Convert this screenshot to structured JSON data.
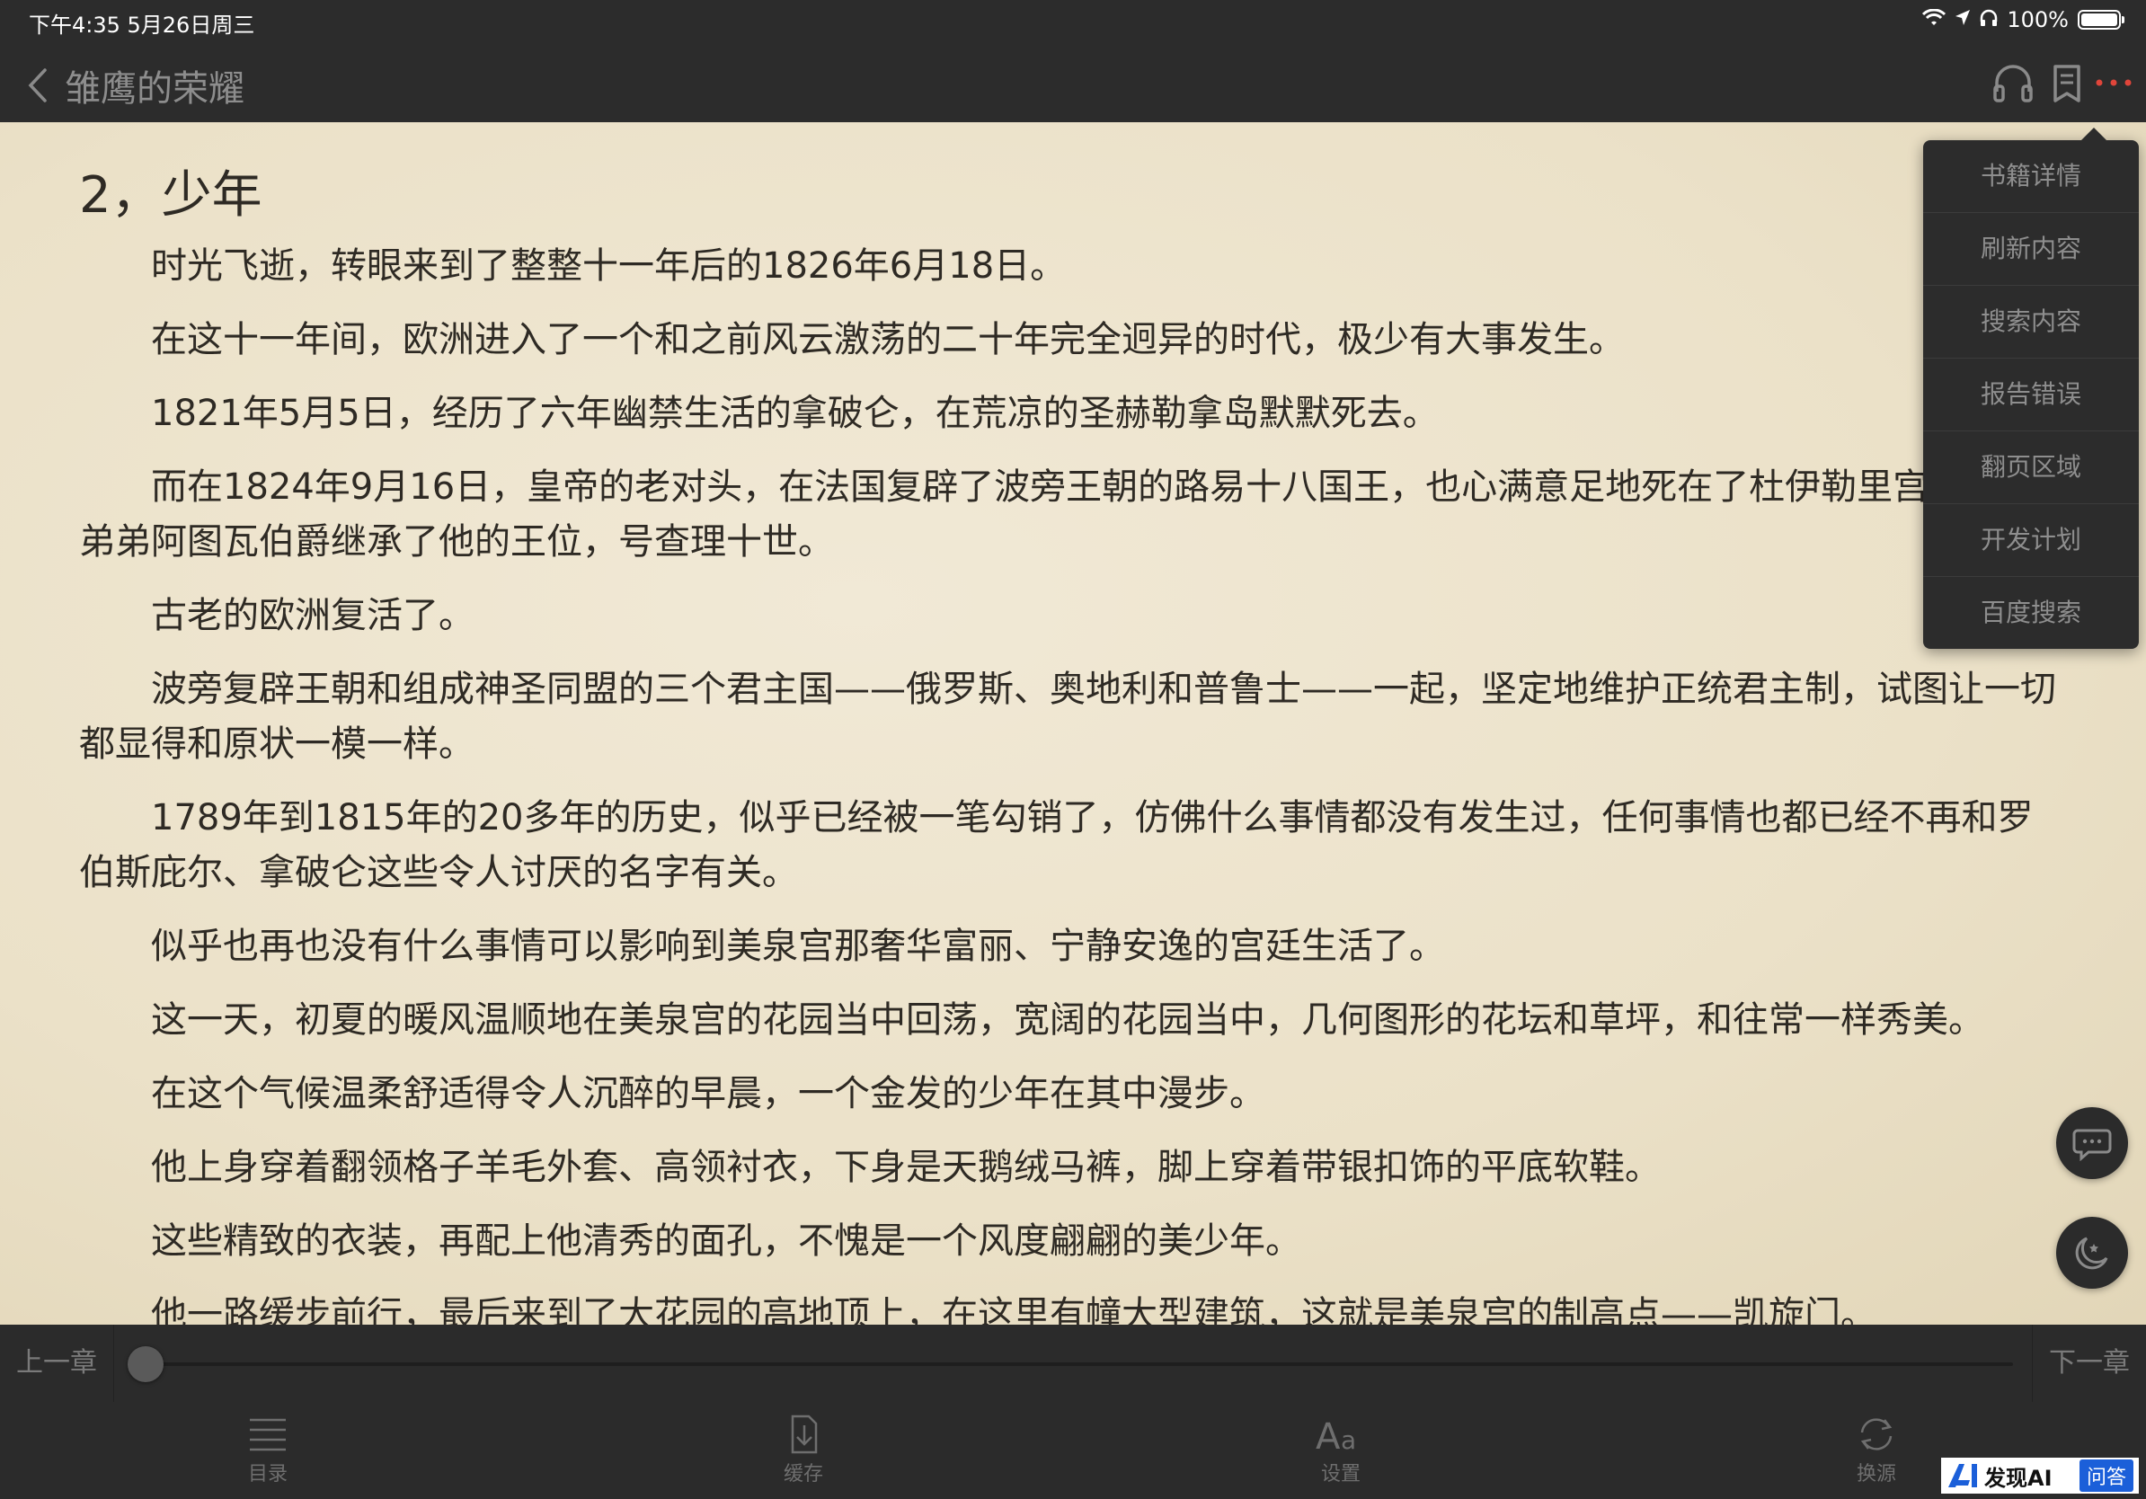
{
  "status_bar": {
    "time_date": "下午4:35   5月26日周三",
    "battery": "100%"
  },
  "nav": {
    "title": "雏鹰的荣耀"
  },
  "chapter": {
    "title": "2，少年",
    "paragraphs": [
      "时光飞逝，转眼来到了整整十一年后的1826年6月18日。",
      "在这十一年间，欧洲进入了一个和之前风云激荡的二十年完全迥异的时代，极少有大事发生。",
      "1821年5月5日，经历了六年幽禁生活的拿破仑，在荒凉的圣赫勒拿岛默默死去。",
      "而在1824年9月16日，皇帝的老对头，在法国复辟了波旁王朝的路易十八国王，也心满意足地死在了杜伊勒里宫，他的弟弟阿图瓦伯爵继承了他的王位，号查理十世。",
      "古老的欧洲复活了。",
      "波旁复辟王朝和组成神圣同盟的三个君主国——俄罗斯、奥地利和普鲁士——一起，坚定地维护正统君主制，试图让一切都显得和原状一模一样。",
      "1789年到1815年的20多年的历史，似乎已经被一笔勾销了，仿佛什么事情都没有发生过，任何事情也都已经不再和罗伯斯庇尔、拿破仑这些令人讨厌的名字有关。",
      "似乎也再也没有什么事情可以影响到美泉宫那奢华富丽、宁静安逸的宫廷生活了。",
      "这一天，初夏的暖风温顺地在美泉宫的花园当中回荡，宽阔的花园当中，几何图形的花坛和草坪，和往常一样秀美。",
      "在这个气候温柔舒适得令人沉醉的早晨，一个金发的少年在其中漫步。",
      "他上身穿着翻领格子羊毛外套、高领衬衣，下身是天鹅绒马裤，脚上穿着带银扣饰的平底软鞋。",
      "这些精致的衣装，再配上他清秀的面孔，不愧是一个风度翩翩的美少年。",
      "他一路缓步前行，最后来到了大花园的高地顶上，在这里有幢大型建筑，这就是美泉宫的制高点——凯旋门。"
    ]
  },
  "menu": {
    "items": [
      "书籍详情",
      "刷新内容",
      "搜索内容",
      "报告错误",
      "翻页区域",
      "开发计划",
      "百度搜索"
    ]
  },
  "progress": {
    "prev_label": "上一章",
    "next_label": "下一章",
    "value": 0
  },
  "toolbar": {
    "toc_label": "目录",
    "cache_label": "缓存",
    "settings_label": "设置",
    "source_label": "换源"
  },
  "watermark": {
    "name": "发现AI",
    "badge": "问答"
  },
  "colors": {
    "bar_bg": "#2c2c2c",
    "page_bg": "#efe6d0",
    "text": "#2e2a24",
    "muted": "#8e8e8e",
    "accent_dots": "#e0453a"
  },
  "icons": {
    "status": [
      "wifi-icon",
      "location-icon",
      "headphone-status-icon",
      "battery-icon"
    ],
    "nav": [
      "back-chevron-icon",
      "headphones-icon",
      "bookmark-icon",
      "more-dots-icon"
    ],
    "float": [
      "chat-bubble-icon",
      "night-mode-icon"
    ],
    "toolbar": [
      "list-icon",
      "download-icon",
      "font-aa-icon",
      "refresh-icon"
    ]
  }
}
